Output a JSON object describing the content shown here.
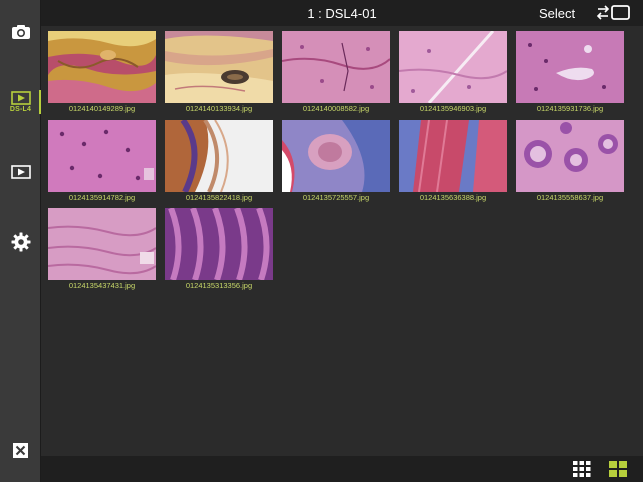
{
  "header": {
    "title": "1 : DSL4-01",
    "select_label": "Select"
  },
  "sidebar": {
    "ds_label": "DS-L4"
  },
  "images": [
    {
      "filename": "0124140149289.jpg"
    },
    {
      "filename": "0124140133934.jpg"
    },
    {
      "filename": "0124140008582.jpg"
    },
    {
      "filename": "0124135946903.jpg"
    },
    {
      "filename": "0124135931736.jpg"
    },
    {
      "filename": "0124135914782.jpg"
    },
    {
      "filename": "0124135822418.jpg"
    },
    {
      "filename": "0124135725557.jpg"
    },
    {
      "filename": "0124135636388.jpg"
    },
    {
      "filename": "0124135558637.jpg"
    },
    {
      "filename": "0124135437431.jpg"
    },
    {
      "filename": "0124135313356.jpg"
    }
  ],
  "icons": {
    "camera": "camera-icon",
    "ds_viewer": "ds-l4-viewer-icon",
    "playback": "playback-icon",
    "settings": "gear-icon",
    "close": "close-icon",
    "swap": "swap-icon",
    "small_grid": "small-grid-icon",
    "large_grid": "large-grid-icon"
  },
  "colors": {
    "accent": "#b7cf3c",
    "filename_text": "#c9d96a"
  }
}
